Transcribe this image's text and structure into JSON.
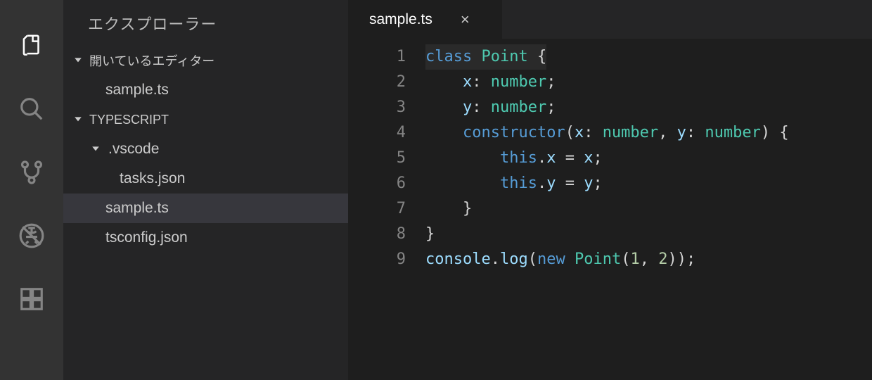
{
  "sidebar": {
    "title": "エクスプローラー",
    "openEditors": {
      "label": "開いているエディター",
      "items": [
        "sample.ts"
      ]
    },
    "workspace": {
      "label": "TYPESCRIPT",
      "folders": [
        {
          "name": ".vscode",
          "children": [
            "tasks.json"
          ]
        }
      ],
      "files": [
        "sample.ts",
        "tsconfig.json"
      ],
      "selected": "sample.ts"
    }
  },
  "tabs": {
    "active": {
      "label": "sample.ts",
      "close": "×"
    }
  },
  "editor": {
    "lineNumbers": [
      "1",
      "2",
      "3",
      "4",
      "5",
      "6",
      "7",
      "8",
      "9"
    ],
    "code": {
      "l1": {
        "kw": "class",
        "type": "Point",
        "brace": " {"
      },
      "l2": {
        "indent": "    ",
        "id": "x",
        "colon": ": ",
        "type": "number",
        "semi": ";"
      },
      "l3": {
        "indent": "    ",
        "id": "y",
        "colon": ": ",
        "type": "number",
        "semi": ";"
      },
      "l4": {
        "indent": "    ",
        "kw": "constructor",
        "open": "(",
        "p1": "x",
        "c1": ": ",
        "t1": "number",
        "comma": ", ",
        "p2": "y",
        "c2": ": ",
        "t2": "number",
        "close": ") {"
      },
      "l5": {
        "indent": "        ",
        "this": "this",
        "dot": ".",
        "prop": "x",
        "eq": " = ",
        "val": "x",
        "semi": ";"
      },
      "l6": {
        "indent": "        ",
        "this": "this",
        "dot": ".",
        "prop": "y",
        "eq": " = ",
        "val": "y",
        "semi": ";"
      },
      "l7": {
        "indent": "    ",
        "brace": "}"
      },
      "l8": {
        "brace": "}"
      },
      "l9": {
        "obj": "console",
        "dot": ".",
        "fn": "log",
        "open": "(",
        "kw": "new",
        "sp": " ",
        "type": "Point",
        "open2": "(",
        "n1": "1",
        "comma": ", ",
        "n2": "2",
        "close": "));"
      }
    }
  }
}
